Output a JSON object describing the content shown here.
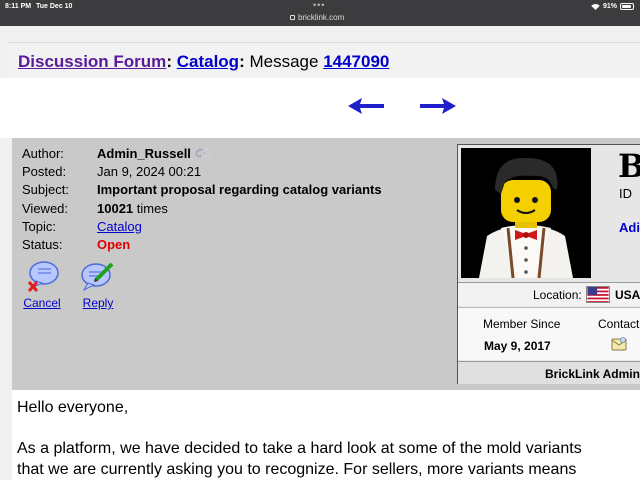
{
  "status_bar": {
    "time": "8:11 PM",
    "date": "Tue Dec 10",
    "battery": "91%",
    "battery_level": 0.91,
    "url": "bricklink.com",
    "dots": "•••"
  },
  "breadcrumb": {
    "forum": "Discussion Forum",
    "catalog": "Catalog",
    "message_label": "Message",
    "message_id": "1447090",
    "sep": ":"
  },
  "message": {
    "labels": {
      "author": "Author:",
      "posted": "Posted:",
      "subject": "Subject:",
      "viewed": "Viewed:",
      "topic": "Topic:",
      "status": "Status:"
    },
    "author": "Admin_Russell",
    "posted": "Jan 9, 2024 00:21",
    "subject": "Important proposal regarding catalog variants",
    "viewed_count": "10021",
    "viewed_suffix": "times",
    "topic": "Catalog",
    "status": "Open"
  },
  "actions": {
    "cancel": "Cancel",
    "reply": "Reply"
  },
  "profile": {
    "big_letter": "B",
    "id_label": "ID",
    "name_fragment": "Adi",
    "location_label": "Location:",
    "location": "USA",
    "member_since_label": "Member Since",
    "member_since": "May 9, 2017",
    "contact_label": "Contact",
    "role": "BrickLink Admin"
  },
  "body": {
    "greeting": "Hello everyone,",
    "line1": "As a platform, we have decided to take a hard look at some of the mold variants",
    "line2": "that we are currently asking you to recognize. For sellers, more variants means"
  },
  "colors": {
    "link": "#0000cc",
    "forum_link": "#5a1a99",
    "status_open": "#e00000",
    "panel": "#c9c9c9"
  }
}
